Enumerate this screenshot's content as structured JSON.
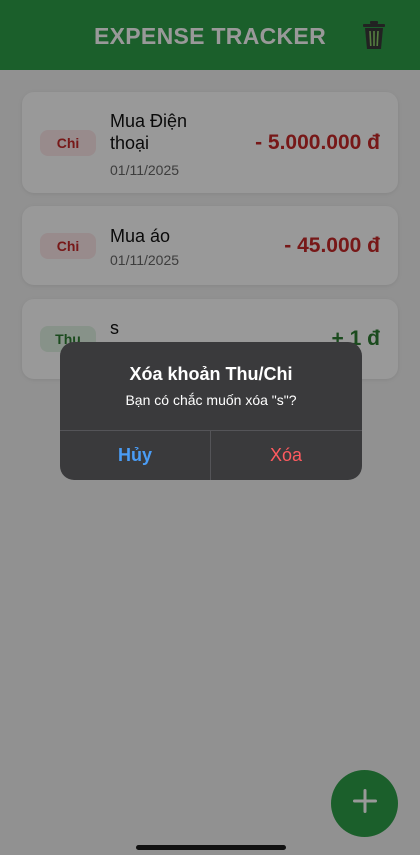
{
  "header": {
    "title": "EXPENSE TRACKER",
    "trash_icon": "trash-icon"
  },
  "transactions": [
    {
      "type_label": "Chi",
      "kind": "expense",
      "title": "Mua Điện thoại",
      "date": "01/11/2025",
      "amount": "- 5.000.000 đ"
    },
    {
      "type_label": "Chi",
      "kind": "expense",
      "title": "Mua áo",
      "date": "01/11/2025",
      "amount": "- 45.000 đ"
    },
    {
      "type_label": "Thu",
      "kind": "income",
      "title": "s",
      "date": "",
      "amount": "+ 1 đ"
    }
  ],
  "dialog": {
    "title": "Xóa khoản Thu/Chi",
    "message": "Bạn có chắc muốn xóa \"s\"?",
    "cancel_label": "Hủy",
    "delete_label": "Xóa"
  },
  "fab": {
    "icon": "plus-icon"
  },
  "colors": {
    "primary": "#2e9e48",
    "expense": "#c62828",
    "income": "#2e7d32",
    "dialog_bg": "#3a3a3c",
    "cancel": "#4a9cf5",
    "delete": "#ff5a5f"
  }
}
